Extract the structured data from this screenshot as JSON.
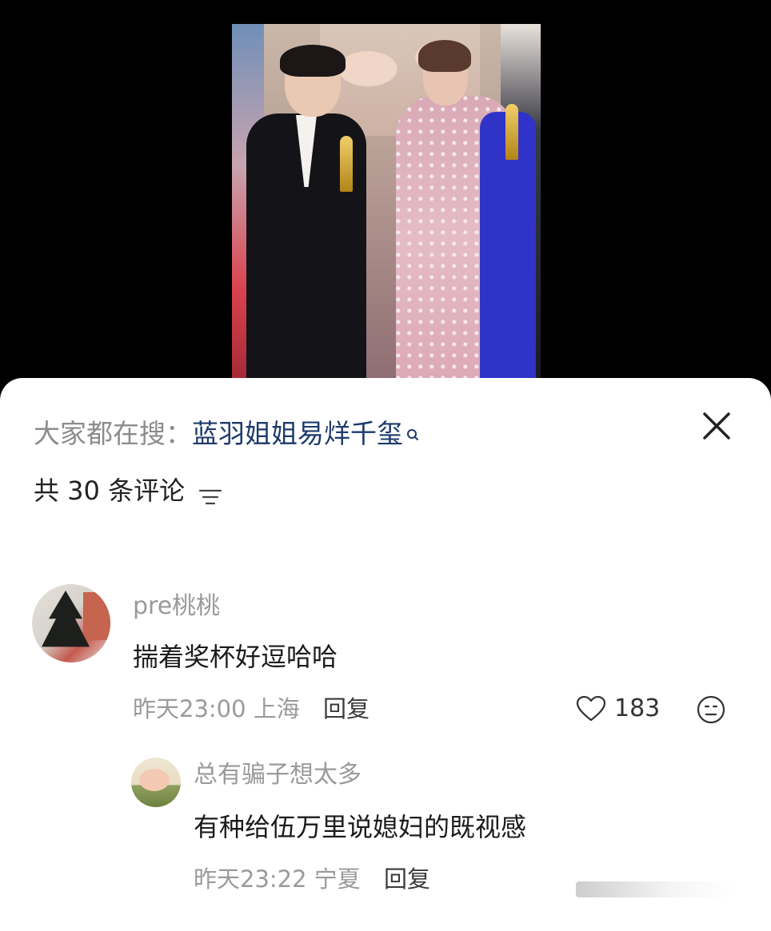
{
  "search": {
    "prefix": "大家都在搜：",
    "term": "蓝羽姐姐易烊千玺"
  },
  "comments_header": {
    "count_label": "共 30 条评论"
  },
  "comment": {
    "user": "pre桃桃",
    "text": "揣着奖杯好逗哈哈",
    "time": "昨天23:00",
    "location": "上海",
    "reply_label": "回复",
    "likes": "183"
  },
  "reply": {
    "user": "总有骗子想太多",
    "text": "有种给伍万里说媳妇的既视感",
    "time": "昨天23:22",
    "location": "宁夏",
    "reply_label": "回复"
  },
  "colors": {
    "search_term": "#1d3a6b",
    "muted": "#9a9a9a",
    "text": "#1b1b1b",
    "background_top": "#000000",
    "sheet": "#ffffff"
  },
  "icons": {
    "search": "search-icon",
    "close": "close-icon",
    "sort": "sort-icon",
    "like": "heart-icon",
    "dislike": "unhappy-face-icon"
  }
}
